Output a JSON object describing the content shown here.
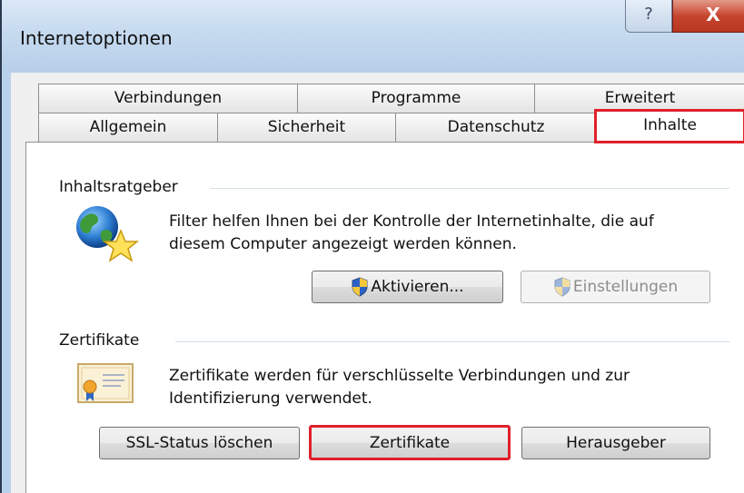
{
  "window": {
    "title": "Internetoptionen",
    "help_glyph": "?",
    "close_glyph": "X"
  },
  "tabs": {
    "row1": [
      "Verbindungen",
      "Programme",
      "Erweitert"
    ],
    "row2": [
      "Allgemein",
      "Sicherheit",
      "Datenschutz",
      "Inhalte"
    ],
    "active": "Inhalte"
  },
  "content_advisor": {
    "label": "Inhaltsratgeber",
    "description_line1": "Filter helfen Ihnen bei der Kontrolle der Internetinhalte, die auf",
    "description_line2": "diesem Computer angezeigt werden können.",
    "enable_button": "Aktivieren...",
    "settings_button": "Einstellungen"
  },
  "certificates": {
    "label": "Zertifikate",
    "description_line1": "Zertifikate werden für verschlüsselte Verbindungen und zur",
    "description_line2": "Identifizierung verwendet.",
    "clear_ssl_button": "SSL-Status löschen",
    "certificates_button": "Zertifikate",
    "publishers_button": "Herausgeber"
  },
  "colors": {
    "highlight": "#e0202a",
    "close_button": "#c7452f",
    "titlebar": "#c6daef"
  }
}
